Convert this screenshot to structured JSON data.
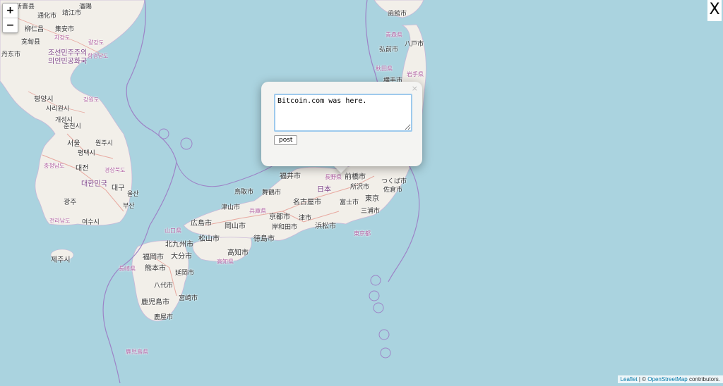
{
  "zoom": {
    "in": "+",
    "out": "−"
  },
  "close_button": "X",
  "popup": {
    "text": "Bitcoin.com was here.",
    "post_label": "post",
    "close_label": "×"
  },
  "attribution": {
    "leaflet": "Leaflet",
    "separator": " | © ",
    "osm": "OpenStreetMap",
    "suffix": " contributors."
  },
  "colors": {
    "water": "#aad3df",
    "land": "#f2efe9",
    "border": "#9d84c7",
    "road": "#e8a9a0"
  },
  "labels": [
    "新晋县",
    "通化市",
    "瀋陽",
    "靖江市",
    "柳仁昌",
    "集安市",
    "宽甸县",
    "丹东市",
    "자강도",
    "조선민주주의",
    "의인민공화국",
    "량강도",
    "함경남도",
    "평양시",
    "사리원시",
    "개성시",
    "강원도",
    "서울",
    "평택시",
    "대전",
    "대한민국",
    "광주",
    "대구",
    "울산",
    "부산",
    "여수시",
    "제주시",
    "춘천시",
    "원주시",
    "경상북도",
    "전라남도",
    "충청남도",
    "福岡市",
    "北九州市",
    "大分市",
    "熊本市",
    "延岡市",
    "八代市",
    "鹿児島市",
    "宮崎市",
    "長崎県",
    "鹿屋市",
    "広島市",
    "松山市",
    "高知市",
    "岡山市",
    "鳥取市",
    "舞鶴市",
    "津山市",
    "京都市",
    "岸和田市",
    "徳島市",
    "兵庫県",
    "山口県",
    "高知県",
    "福井市",
    "名古屋市",
    "津市",
    "浜松市",
    "富士市",
    "三浦市",
    "東京",
    "前橋市",
    "佐倉市",
    "所沢市",
    "つくば市",
    "長野県",
    "日本",
    "東京都",
    "弘前市",
    "八戸市",
    "横手市",
    "秋田県",
    "岩手県",
    "青森県",
    "函館市",
    "鹿児島県"
  ]
}
